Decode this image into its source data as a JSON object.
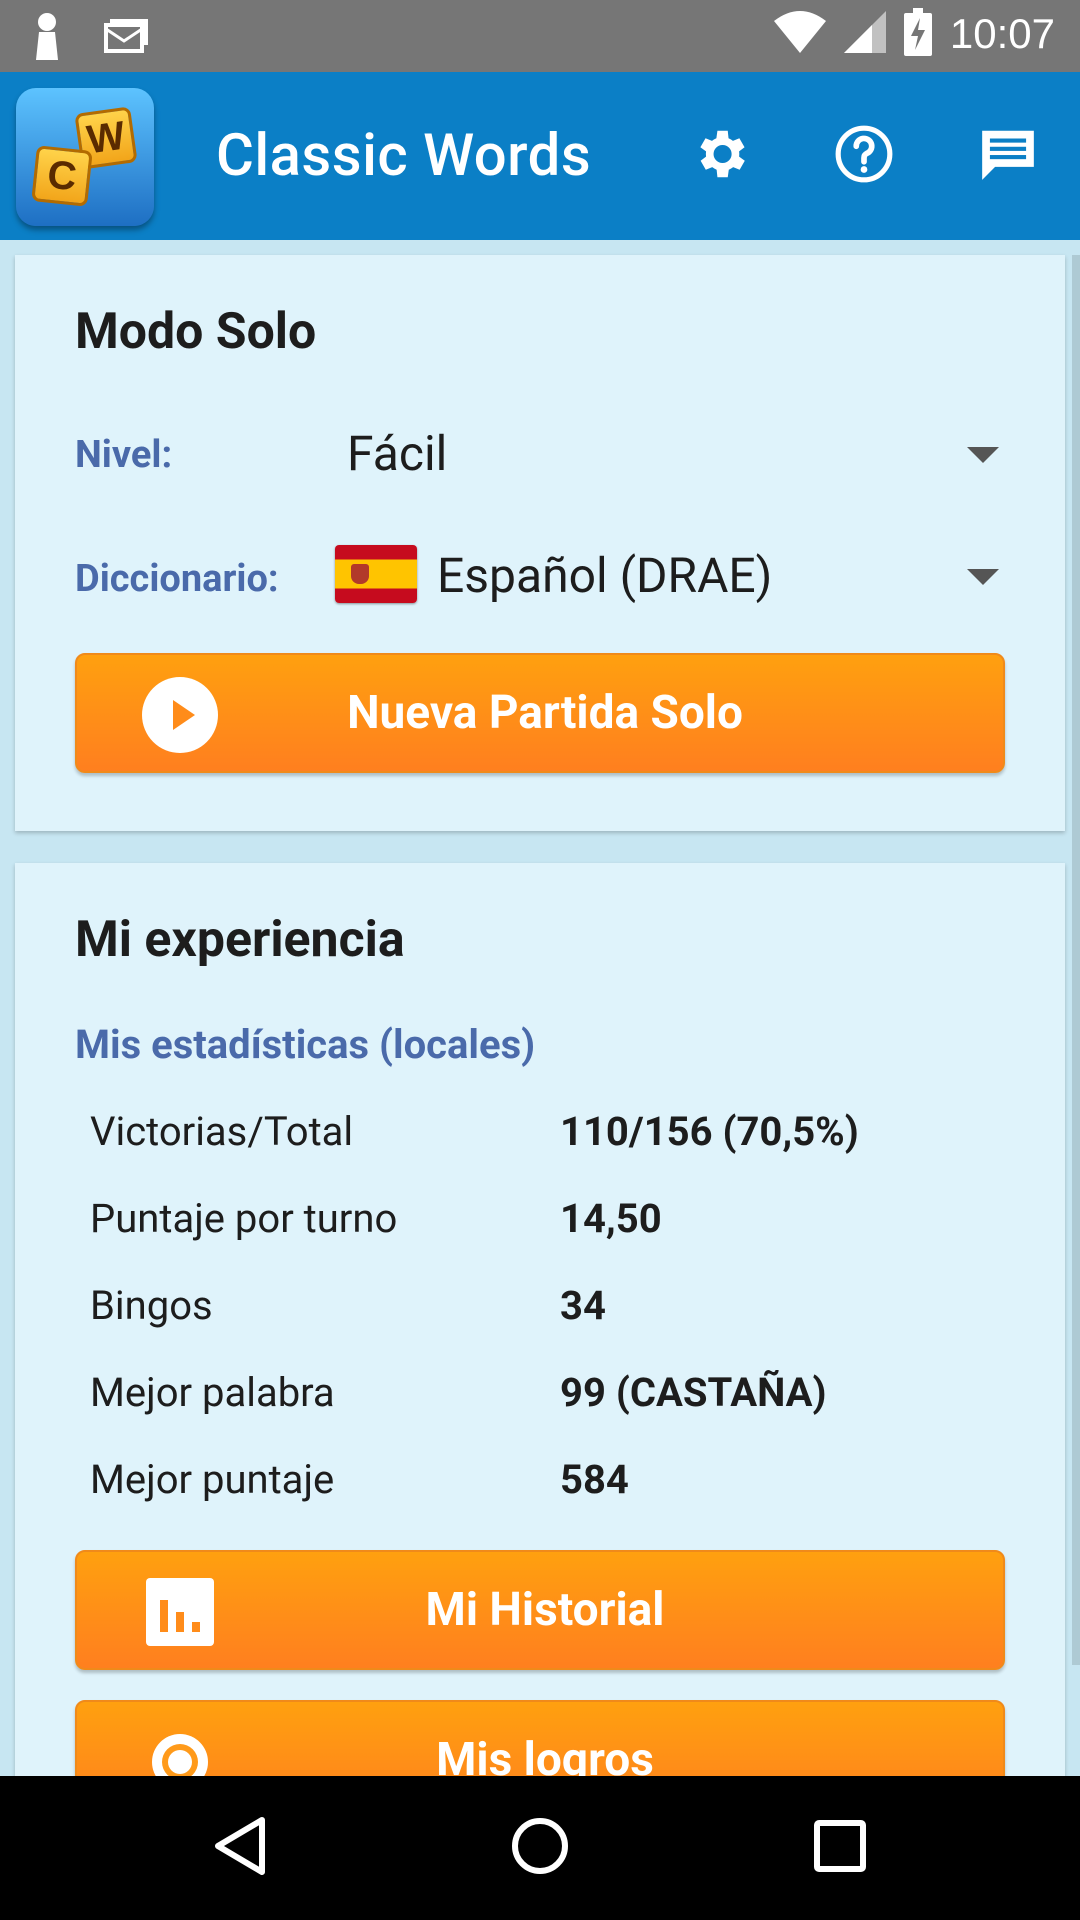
{
  "status_bar": {
    "time": "10:07"
  },
  "app": {
    "title": "Classic Words",
    "logo_tiles": [
      "W",
      "C"
    ]
  },
  "solo": {
    "title": "Modo Solo",
    "level_label": "Nivel:",
    "level_value": "Fácil",
    "dictionary_label": "Diccionario:",
    "dictionary_value": "Español (DRAE)",
    "new_game_button": "Nueva Partida Solo"
  },
  "experience": {
    "title": "Mi experiencia",
    "stats_title": "Mis estadísticas (locales)",
    "stats": [
      {
        "label": "Victorias/Total",
        "value": "110/156 (70,5%)"
      },
      {
        "label": "Puntaje por turno",
        "value": "14,50"
      },
      {
        "label": "Bingos",
        "value": "34"
      },
      {
        "label": "Mejor palabra",
        "value": "99 (CASTAÑA)"
      },
      {
        "label": "Mejor puntaje",
        "value": "584"
      }
    ],
    "history_button": "Mi Historial",
    "achievements_button": "Mis logros"
  },
  "colors": {
    "app_bar": "#0b7fc6",
    "status_bar": "#767676",
    "card": "#dff3fb",
    "button": "#ff9018",
    "label_blue": "#4a6aaa"
  },
  "icons": {
    "settings": "gear-icon",
    "help": "help-circle-icon",
    "chat": "chat-icon",
    "play": "play-circle-icon",
    "history": "bar-chart-icon",
    "achievements": "medal-icon"
  }
}
